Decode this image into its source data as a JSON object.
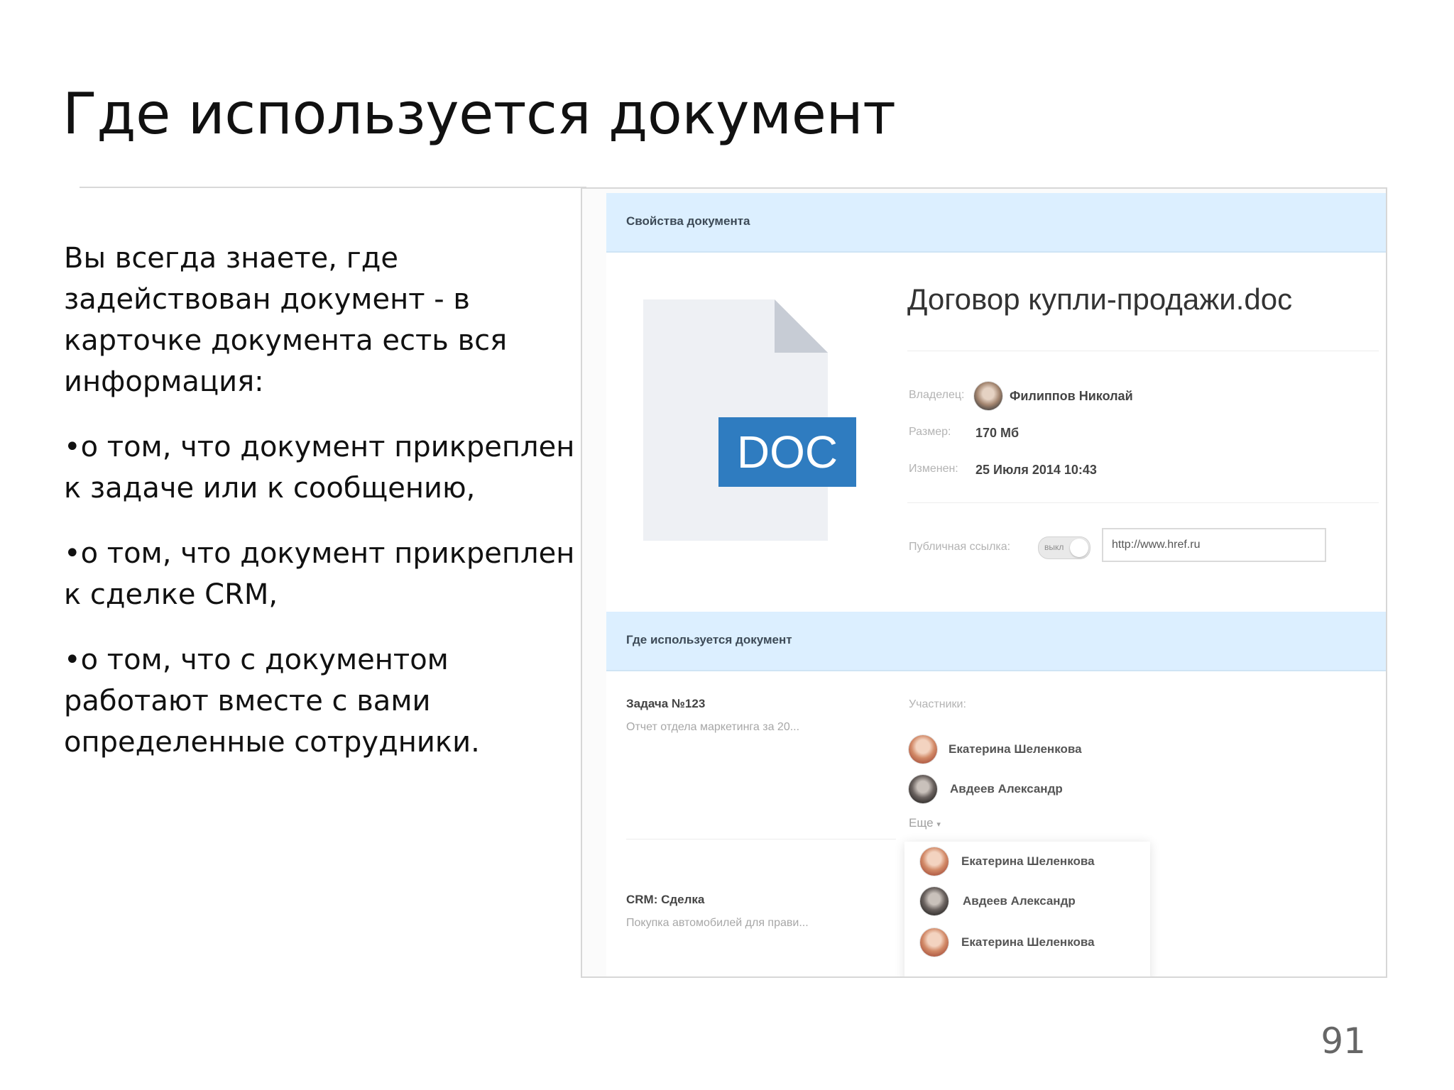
{
  "slide": {
    "title": "Где используется документ",
    "paragraphs": [
      "Вы всегда знаете, где задействован документ - в карточке документа есть вся информация:",
      "•о том, что документ прикреплен к задаче или к сообщению,",
      "•о том, что документ прикреплен к сделке CRM,",
      "•о том, что с документом работают вместе с вами определенные сотрудники."
    ],
    "page_number": "91"
  },
  "screenshot": {
    "properties_header": "Свойства документа",
    "doc_badge": "DOC",
    "file_name": "Договор купли-продажи.doc",
    "owner_label": "Владелец:",
    "owner_name": "Филиппов Николай",
    "size_label": "Размер:",
    "size_value": "170 Мб",
    "modified_label": "Изменен:",
    "modified_value": "25 Июля 2014 10:43",
    "public_link_label": "Публичная ссылка:",
    "toggle_text": "выкл",
    "public_link_value": "http://www.href.ru",
    "usage_header": "Где используется документ",
    "task_title": "Задача №123",
    "task_subtitle": "Отчет отдела маркетинга за 20...",
    "participants_label": "Участники:",
    "participants": [
      "Екатерина Шеленкова",
      "Авдеев Александр"
    ],
    "more_label": "Еще",
    "crm_title": "CRM: Сделка",
    "crm_subtitle": "Покупка автомобилей для прави...",
    "dropdown_people": [
      "Екатерина Шеленкова",
      "Авдеев Александр",
      "Екатерина Шеленкова"
    ],
    "colors": {
      "accent_bar": "#dcefff",
      "doc_badge": "#2f7cc0",
      "doc_page": "#eef0f4",
      "doc_fold": "#c7ccd5"
    }
  }
}
